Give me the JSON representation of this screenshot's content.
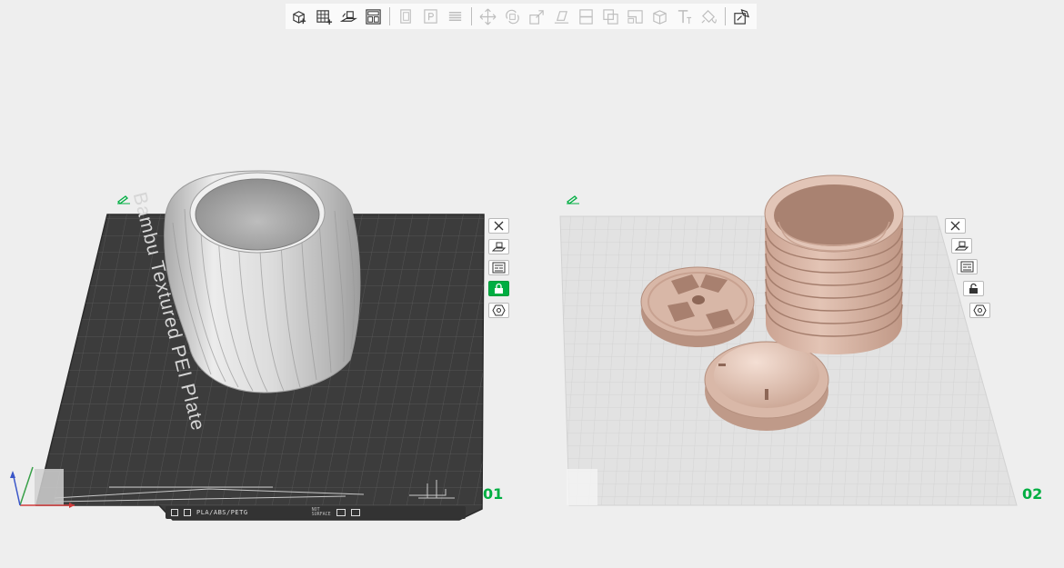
{
  "toolbar": {
    "buttons": [
      {
        "name": "add-object",
        "enabled": true
      },
      {
        "name": "add-plate",
        "enabled": true
      },
      {
        "name": "auto-orient",
        "enabled": true
      },
      {
        "name": "arrange",
        "enabled": true
      },
      {
        "name": "copy",
        "enabled": false
      },
      {
        "name": "paste",
        "enabled": false
      },
      {
        "name": "layers",
        "enabled": false
      },
      {
        "name": "move",
        "enabled": false
      },
      {
        "name": "rotate",
        "enabled": false
      },
      {
        "name": "scale",
        "enabled": false
      },
      {
        "name": "lay-on-face",
        "enabled": false
      },
      {
        "name": "cut",
        "enabled": false
      },
      {
        "name": "boolean",
        "enabled": false
      },
      {
        "name": "split",
        "enabled": false
      },
      {
        "name": "support-paint",
        "enabled": false
      },
      {
        "name": "text",
        "enabled": false
      },
      {
        "name": "color-paint",
        "enabled": false
      },
      {
        "name": "assembly",
        "enabled": true
      }
    ]
  },
  "plates": [
    {
      "number": "01",
      "type": "dark-textured",
      "label": "Bambu Textured PEI Plate",
      "strip_text": "PLA/ABS/PETG",
      "strip_subtext": [
        "NOT",
        "SURFACE"
      ],
      "locked": true,
      "objects": [
        "twisted-vase"
      ]
    },
    {
      "number": "02",
      "type": "light",
      "locked": false,
      "objects": [
        "spring-coil",
        "slotted-disc",
        "dome-cap"
      ]
    }
  ],
  "plate_buttons": [
    "close",
    "orient",
    "arrange",
    "lock",
    "settings"
  ],
  "colors": {
    "accent": "#00ae42",
    "background": "#eeeeee",
    "dark_plate": "#3b3b3b",
    "light_plate": "#e2e2e2",
    "vase": "#d9d9d9",
    "filament_pink": "#d8b7a7"
  }
}
